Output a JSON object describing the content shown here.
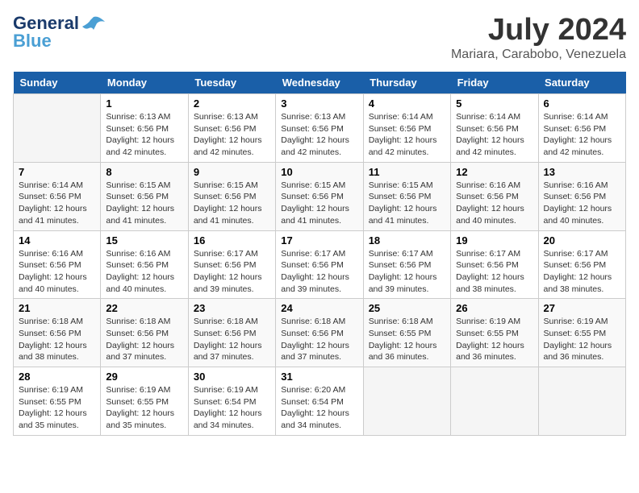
{
  "header": {
    "logo_line1": "General",
    "logo_line2": "Blue",
    "month": "July 2024",
    "location": "Mariara, Carabobo, Venezuela"
  },
  "weekdays": [
    "Sunday",
    "Monday",
    "Tuesday",
    "Wednesday",
    "Thursday",
    "Friday",
    "Saturday"
  ],
  "weeks": [
    [
      {
        "day": "",
        "sunrise": "",
        "sunset": "",
        "daylight": "",
        "empty": true
      },
      {
        "day": "1",
        "sunrise": "Sunrise: 6:13 AM",
        "sunset": "Sunset: 6:56 PM",
        "daylight": "Daylight: 12 hours and 42 minutes."
      },
      {
        "day": "2",
        "sunrise": "Sunrise: 6:13 AM",
        "sunset": "Sunset: 6:56 PM",
        "daylight": "Daylight: 12 hours and 42 minutes."
      },
      {
        "day": "3",
        "sunrise": "Sunrise: 6:13 AM",
        "sunset": "Sunset: 6:56 PM",
        "daylight": "Daylight: 12 hours and 42 minutes."
      },
      {
        "day": "4",
        "sunrise": "Sunrise: 6:14 AM",
        "sunset": "Sunset: 6:56 PM",
        "daylight": "Daylight: 12 hours and 42 minutes."
      },
      {
        "day": "5",
        "sunrise": "Sunrise: 6:14 AM",
        "sunset": "Sunset: 6:56 PM",
        "daylight": "Daylight: 12 hours and 42 minutes."
      },
      {
        "day": "6",
        "sunrise": "Sunrise: 6:14 AM",
        "sunset": "Sunset: 6:56 PM",
        "daylight": "Daylight: 12 hours and 42 minutes."
      }
    ],
    [
      {
        "day": "7",
        "sunrise": "Sunrise: 6:14 AM",
        "sunset": "Sunset: 6:56 PM",
        "daylight": "Daylight: 12 hours and 41 minutes."
      },
      {
        "day": "8",
        "sunrise": "Sunrise: 6:15 AM",
        "sunset": "Sunset: 6:56 PM",
        "daylight": "Daylight: 12 hours and 41 minutes."
      },
      {
        "day": "9",
        "sunrise": "Sunrise: 6:15 AM",
        "sunset": "Sunset: 6:56 PM",
        "daylight": "Daylight: 12 hours and 41 minutes."
      },
      {
        "day": "10",
        "sunrise": "Sunrise: 6:15 AM",
        "sunset": "Sunset: 6:56 PM",
        "daylight": "Daylight: 12 hours and 41 minutes."
      },
      {
        "day": "11",
        "sunrise": "Sunrise: 6:15 AM",
        "sunset": "Sunset: 6:56 PM",
        "daylight": "Daylight: 12 hours and 41 minutes."
      },
      {
        "day": "12",
        "sunrise": "Sunrise: 6:16 AM",
        "sunset": "Sunset: 6:56 PM",
        "daylight": "Daylight: 12 hours and 40 minutes."
      },
      {
        "day": "13",
        "sunrise": "Sunrise: 6:16 AM",
        "sunset": "Sunset: 6:56 PM",
        "daylight": "Daylight: 12 hours and 40 minutes."
      }
    ],
    [
      {
        "day": "14",
        "sunrise": "Sunrise: 6:16 AM",
        "sunset": "Sunset: 6:56 PM",
        "daylight": "Daylight: 12 hours and 40 minutes."
      },
      {
        "day": "15",
        "sunrise": "Sunrise: 6:16 AM",
        "sunset": "Sunset: 6:56 PM",
        "daylight": "Daylight: 12 hours and 40 minutes."
      },
      {
        "day": "16",
        "sunrise": "Sunrise: 6:17 AM",
        "sunset": "Sunset: 6:56 PM",
        "daylight": "Daylight: 12 hours and 39 minutes."
      },
      {
        "day": "17",
        "sunrise": "Sunrise: 6:17 AM",
        "sunset": "Sunset: 6:56 PM",
        "daylight": "Daylight: 12 hours and 39 minutes."
      },
      {
        "day": "18",
        "sunrise": "Sunrise: 6:17 AM",
        "sunset": "Sunset: 6:56 PM",
        "daylight": "Daylight: 12 hours and 39 minutes."
      },
      {
        "day": "19",
        "sunrise": "Sunrise: 6:17 AM",
        "sunset": "Sunset: 6:56 PM",
        "daylight": "Daylight: 12 hours and 38 minutes."
      },
      {
        "day": "20",
        "sunrise": "Sunrise: 6:17 AM",
        "sunset": "Sunset: 6:56 PM",
        "daylight": "Daylight: 12 hours and 38 minutes."
      }
    ],
    [
      {
        "day": "21",
        "sunrise": "Sunrise: 6:18 AM",
        "sunset": "Sunset: 6:56 PM",
        "daylight": "Daylight: 12 hours and 38 minutes."
      },
      {
        "day": "22",
        "sunrise": "Sunrise: 6:18 AM",
        "sunset": "Sunset: 6:56 PM",
        "daylight": "Daylight: 12 hours and 37 minutes."
      },
      {
        "day": "23",
        "sunrise": "Sunrise: 6:18 AM",
        "sunset": "Sunset: 6:56 PM",
        "daylight": "Daylight: 12 hours and 37 minutes."
      },
      {
        "day": "24",
        "sunrise": "Sunrise: 6:18 AM",
        "sunset": "Sunset: 6:56 PM",
        "daylight": "Daylight: 12 hours and 37 minutes."
      },
      {
        "day": "25",
        "sunrise": "Sunrise: 6:18 AM",
        "sunset": "Sunset: 6:55 PM",
        "daylight": "Daylight: 12 hours and 36 minutes."
      },
      {
        "day": "26",
        "sunrise": "Sunrise: 6:19 AM",
        "sunset": "Sunset: 6:55 PM",
        "daylight": "Daylight: 12 hours and 36 minutes."
      },
      {
        "day": "27",
        "sunrise": "Sunrise: 6:19 AM",
        "sunset": "Sunset: 6:55 PM",
        "daylight": "Daylight: 12 hours and 36 minutes."
      }
    ],
    [
      {
        "day": "28",
        "sunrise": "Sunrise: 6:19 AM",
        "sunset": "Sunset: 6:55 PM",
        "daylight": "Daylight: 12 hours and 35 minutes."
      },
      {
        "day": "29",
        "sunrise": "Sunrise: 6:19 AM",
        "sunset": "Sunset: 6:55 PM",
        "daylight": "Daylight: 12 hours and 35 minutes."
      },
      {
        "day": "30",
        "sunrise": "Sunrise: 6:19 AM",
        "sunset": "Sunset: 6:54 PM",
        "daylight": "Daylight: 12 hours and 34 minutes."
      },
      {
        "day": "31",
        "sunrise": "Sunrise: 6:20 AM",
        "sunset": "Sunset: 6:54 PM",
        "daylight": "Daylight: 12 hours and 34 minutes."
      },
      {
        "day": "",
        "empty": true
      },
      {
        "day": "",
        "empty": true
      },
      {
        "day": "",
        "empty": true
      }
    ]
  ]
}
